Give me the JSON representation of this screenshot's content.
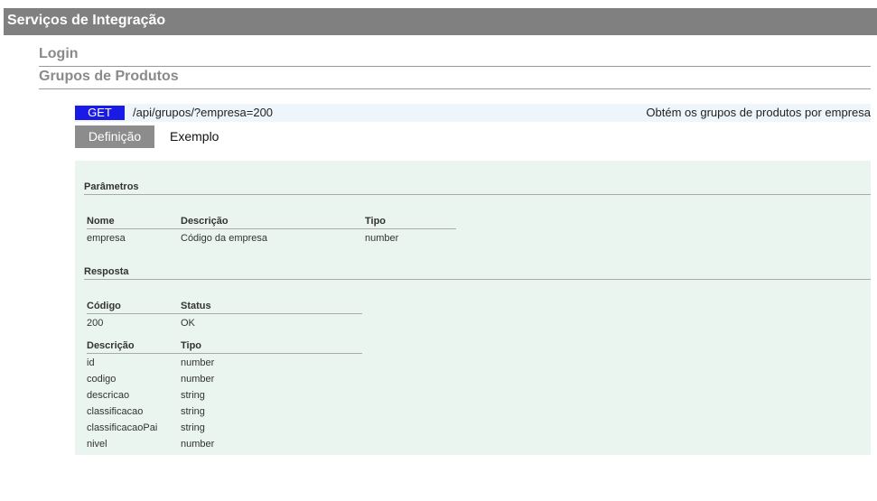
{
  "header": {
    "title": "Serviços de Integração"
  },
  "sections": {
    "login": "Login",
    "grupos": "Grupos de Produtos"
  },
  "endpoint": {
    "method": "GET",
    "path": "/api/grupos/?empresa=200",
    "summary": "Obtém os grupos de produtos por empresa"
  },
  "tabs": {
    "definicao": "Definição",
    "exemplo": "Exemplo"
  },
  "parametros": {
    "title": "Parâmetros",
    "columns": [
      "Nome",
      "Descrição",
      "Tipo"
    ],
    "rows": [
      [
        "empresa",
        "Código da empresa",
        "number"
      ]
    ]
  },
  "resposta": {
    "title": "Resposta",
    "status_columns": [
      "Código",
      "Status"
    ],
    "status_rows": [
      [
        "200",
        "OK"
      ]
    ],
    "field_columns": [
      "Descrição",
      "Tipo"
    ],
    "field_rows": [
      [
        "id",
        "number"
      ],
      [
        "codigo",
        "number"
      ],
      [
        "descricao",
        "string"
      ],
      [
        "classificacao",
        "string"
      ],
      [
        "classificacaoPai",
        "string"
      ],
      [
        "nivel",
        "number"
      ]
    ]
  },
  "colors": {
    "header_bg": "#808080",
    "method_bg": "#1a1ae6",
    "panel_bg": "#e9f5ee",
    "bar_bg": "#eef5fb"
  }
}
